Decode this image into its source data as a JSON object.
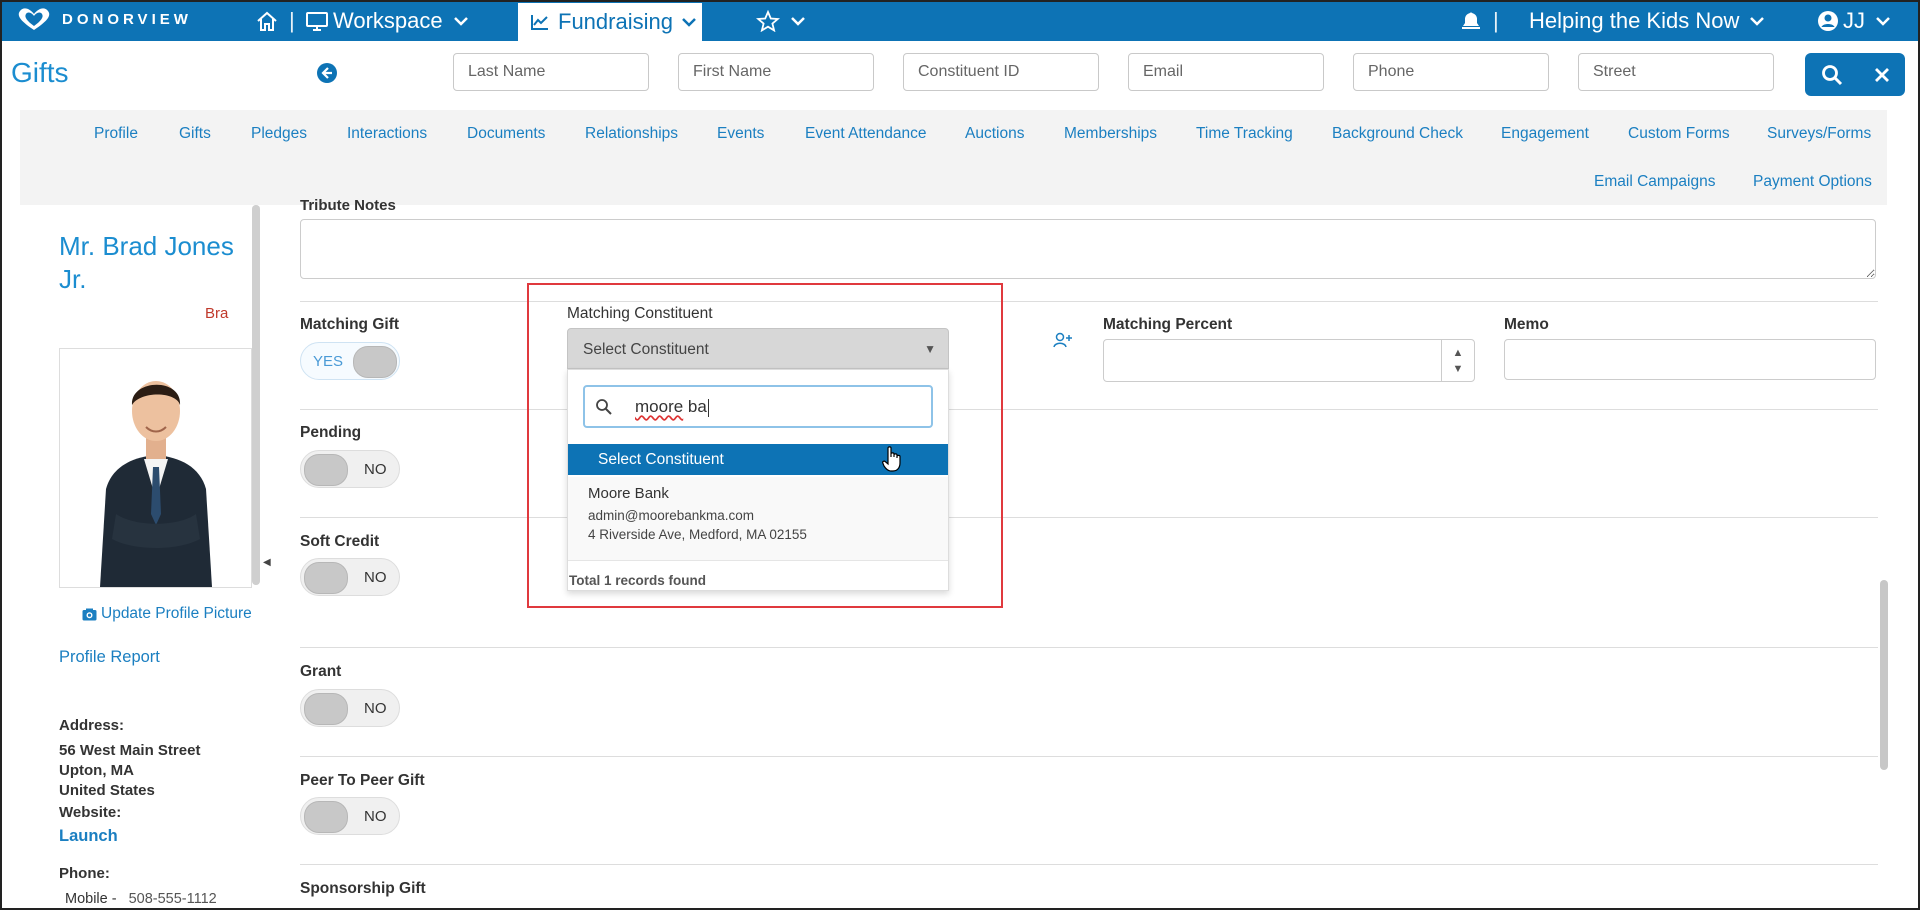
{
  "topbar": {
    "logo_text": "DONORVIEW",
    "workspace_label": "Workspace",
    "fundraising_label": "Fundraising",
    "org_label": "Helping the Kids Now",
    "user_initials": "JJ",
    "separator": "|"
  },
  "header": {
    "page_title": "Gifts",
    "search": {
      "last_name": "Last Name",
      "first_name": "First Name",
      "constituent_id": "Constituent ID",
      "email": "Email",
      "phone": "Phone",
      "street": "Street"
    }
  },
  "nav": {
    "items": [
      "Profile",
      "Gifts",
      "Pledges",
      "Interactions",
      "Documents",
      "Relationships",
      "Events",
      "Event Attendance",
      "Auctions",
      "Memberships",
      "Time Tracking",
      "Background Check",
      "Engagement",
      "Custom Forms",
      "Surveys/Forms",
      "Email Campaigns",
      "Payment Options"
    ]
  },
  "profile": {
    "name": "Mr. Brad Jones Jr.",
    "short_name": "Bra",
    "update_picture": "Update Profile Picture",
    "profile_report": "Profile Report",
    "address_label": "Address:",
    "address_line1": "56 West Main Street",
    "address_line2": "Upton, MA",
    "address_line3": "United States",
    "website_label": "Website:",
    "website_link": "Launch",
    "phone_label": "Phone:",
    "phone_type": "Mobile -",
    "phone_value": "508-555-1112"
  },
  "form": {
    "tribute_notes_label": "Tribute Notes",
    "matching_gift_label": "Matching Gift",
    "matching_gift_value": "YES",
    "matching_constituent_label": "Matching Constituent",
    "matching_percent_label": "Matching Percent",
    "memo_label": "Memo",
    "pending_label": "Pending",
    "pending_value": "NO",
    "soft_credit_label": "Soft Credit",
    "soft_credit_value": "NO",
    "grant_label": "Grant",
    "grant_value": "NO",
    "peer_label": "Peer To Peer Gift",
    "peer_value": "NO",
    "sponsorship_label": "Sponsorship Gift"
  },
  "dropdown": {
    "selected": "Select Constituent",
    "search_prefix": "moore",
    "search_suffix": " ba",
    "highlight": "Select Constituent",
    "result": {
      "name": "Moore Bank",
      "email": "admin@moorebankma.com",
      "address": "4 Riverside Ave, Medford, MA 02155"
    },
    "total": "Total 1 records found"
  },
  "colors": {
    "brand": "#0d73b5",
    "link": "#1b7fc1",
    "highlight_box": "#e0393e"
  }
}
